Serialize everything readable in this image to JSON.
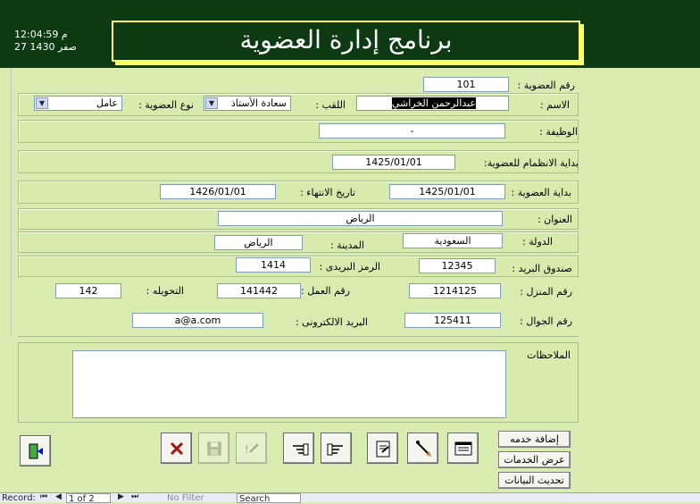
{
  "header": {
    "time": "12:04:59 م",
    "date": "27 صفر 1430",
    "title": "برنامج إدارة العضوية"
  },
  "form": {
    "member_no_label": "رقم العضوية :",
    "member_no": "101",
    "name_label": "الاسم :",
    "name_value": "عبدالرحمن الخراشي",
    "honorific_label": "اللقب :",
    "honorific_value": "سعادة الأستاذ",
    "membership_type_label": "نوع العضوية :",
    "membership_type_value": "عامل",
    "job_label": "الوظيفة :",
    "job_value": "-",
    "join_start_label": "بداية الانظمام للعضوية:",
    "join_start_value": "1425/01/01",
    "membership_start_label": "بداية العضوية :",
    "membership_start_value": "1425/01/01",
    "end_date_label": "تاريخ الانتهاء :",
    "end_date_value": "1426/01/01",
    "address_label": "العنوان :",
    "address_value": "الرياض",
    "country_label": "الدولة :",
    "country_value": "السعودية",
    "city_label": "المدينة :",
    "city_value": "الرياض",
    "pobox_label": "صندوق البريد :",
    "pobox_value": "12345",
    "postal_label": "الرمز البريدى :",
    "postal_value": "1414",
    "home_phone_label": "رقم المنزل :",
    "home_phone_value": "1214125",
    "work_phone_label": "رقم العمل :",
    "work_phone_value": "141442",
    "ext_label": "التحويله :",
    "ext_value": "142",
    "mobile_label": "رقم الجوال :",
    "mobile_value": "125411",
    "email_label": "البريد الالكترونى :",
    "email_value": "a@a.com",
    "notes_label": "الملاحظات"
  },
  "buttons": {
    "add_service": "إضافة خدمه",
    "show_services": "عرض الخدمات",
    "update_data": "تحديث البيانات"
  },
  "statusbar": {
    "record_label": "Record:",
    "record_value": "1 of 2",
    "filter": "No Filter",
    "search": "Search"
  },
  "colors": {
    "header_bg": "#0d3a12",
    "title_border": "#ffff66",
    "form_bg": "#d9ecb0"
  }
}
